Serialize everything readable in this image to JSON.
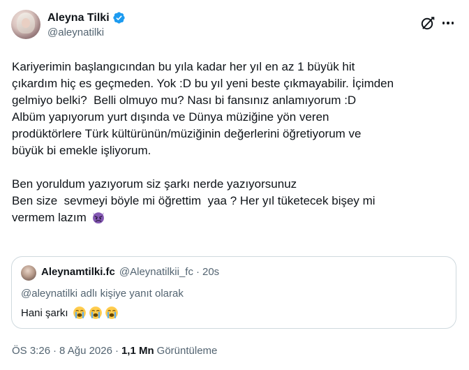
{
  "author": {
    "display_name": "Aleyna Tilki",
    "handle": "@aleynatilki",
    "verified_icon": "verified-badge-icon",
    "accent_color": "#1d9bf0"
  },
  "actions": {
    "grok_icon": "grok-icon",
    "more_icon": "more-options-icon"
  },
  "tweet": {
    "lines": [
      "Kariyerimin başlangıcından bu yıla kadar her yıl en az 1 büyük hit",
      "çıkardım hiç es geçmeden. Yok :D bu yıl yeni beste çıkmayabilir. İçimden",
      "gelmiyo belki?  Belli olmuyo mu? Nası bi fansınız anlamıyorum :D",
      "Albüm yapıyorum yurt dışında ve Dünya müziğine yön veren",
      "prodüktörlere Türk kültürünün/müziğinin değerlerini öğretiyorum ve",
      "büyük bi emekle işliyorum.",
      "",
      "Ben yoruldum yazıyorum siz şarkı nerde yazıyorsunuz",
      "Ben size  sevmeyi böyle mi öğrettim  yaa ? Her yıl tüketecek bişey mi",
      "vermem lazım"
    ],
    "trailing_emoji": "angry-devil-emoji"
  },
  "quote": {
    "display_name": "Aleynamtilki.fc",
    "handle": "@Aleynatilkii_fc",
    "separator": "·",
    "time": "20s",
    "reply_context": "@aleynatilki adlı kişiye yanıt olarak",
    "text": "Hani şarkı",
    "emojis": [
      "crying-face-emoji",
      "crying-face-emoji",
      "crying-face-emoji"
    ]
  },
  "footer": {
    "time": "ÖS 3:26",
    "separator": "·",
    "date": "8 Ağu 2026",
    "views_count": "1,1 Mn",
    "views_label": "Görüntüleme"
  }
}
